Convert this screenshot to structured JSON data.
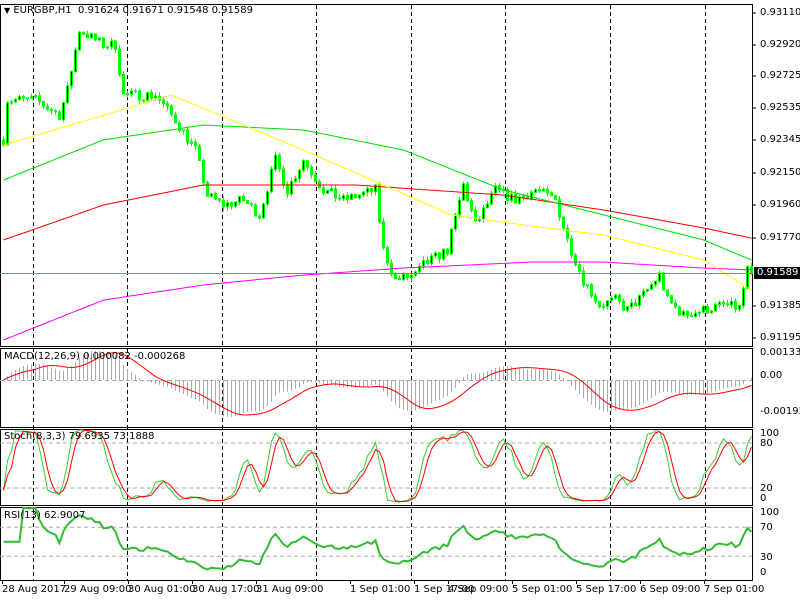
{
  "header": {
    "symbol_icon": "triangle-down-icon",
    "title": "EURGBP,H1",
    "open": "0.91624",
    "high": "0.91671",
    "low": "0.91548",
    "close": "0.91589"
  },
  "colors": {
    "candle": "#00ff00",
    "ma_fast": "#ffff00",
    "ma_mid": "#00dd00",
    "ma_slow": "#ff0000",
    "ma_long": "#ff00ff",
    "signal": "#ff0000",
    "stoch_main": "#33cc33",
    "stoch_signal": "#ff0000",
    "rsi": "#33bb33",
    "grid": "#000000"
  },
  "price_axis": [
    "0.93110",
    "0.92920",
    "0.92725",
    "0.92535",
    "0.92345",
    "0.92150",
    "0.91960",
    "0.91770",
    "0.91589",
    "0.91385",
    "0.91195"
  ],
  "current_price": "0.91589",
  "macd": {
    "label": "MACD(12,26,9) 0.000082 -0.000268",
    "axis": [
      "0.001335",
      "0.00",
      "-0.001927"
    ]
  },
  "stoch": {
    "label": "Stoch(8,3,3) 79.6935 73.1888",
    "axis": [
      "100",
      "80",
      "20",
      "0"
    ]
  },
  "rsi": {
    "label": "RSI(13) 62.9007",
    "axis": [
      "100",
      "70",
      "30",
      "0"
    ]
  },
  "time_axis": [
    "28 Aug 2017",
    "29 Aug 09:00",
    "30 Aug 01:00",
    "30 Aug 17:00",
    "31 Aug 09:00",
    "1 Sep 01:00",
    "1 Sep 17:00",
    "4 Sep 09:00",
    "5 Sep 01:00",
    "5 Sep 17:00",
    "6 Sep 09:00",
    "7 Sep 01:00"
  ],
  "chart_data": {
    "type": "candlestick",
    "bars": 188,
    "price_range": [
      0.91195,
      0.9311
    ],
    "close_anchors": [
      [
        0,
        0.92369
      ],
      [
        1,
        0.92602
      ],
      [
        8,
        0.92602
      ],
      [
        14,
        0.92514
      ],
      [
        16,
        0.9266
      ],
      [
        19,
        0.93011
      ],
      [
        25,
        0.92923
      ],
      [
        28,
        0.92923
      ],
      [
        30,
        0.92631
      ],
      [
        38,
        0.92631
      ],
      [
        43,
        0.92485
      ],
      [
        48,
        0.9231
      ],
      [
        51,
        0.92047
      ],
      [
        55,
        0.91989
      ],
      [
        60,
        0.92018
      ],
      [
        64,
        0.91931
      ],
      [
        68,
        0.92252
      ],
      [
        71,
        0.92077
      ],
      [
        75,
        0.92252
      ],
      [
        80,
        0.92077
      ],
      [
        85,
        0.92018
      ],
      [
        93,
        0.92077
      ],
      [
        95,
        0.91726
      ],
      [
        98,
        0.91551
      ],
      [
        103,
        0.9158
      ],
      [
        105,
        0.91639
      ],
      [
        111,
        0.91726
      ],
      [
        115,
        0.92106
      ],
      [
        118,
        0.91872
      ],
      [
        123,
        0.92077
      ],
      [
        128,
        0.92018
      ],
      [
        133,
        0.92077
      ],
      [
        138,
        0.92018
      ],
      [
        141,
        0.91785
      ],
      [
        145,
        0.91551
      ],
      [
        149,
        0.91405
      ],
      [
        153,
        0.91434
      ],
      [
        156,
        0.91376
      ],
      [
        160,
        0.91464
      ],
      [
        164,
        0.9158
      ],
      [
        166,
        0.91434
      ],
      [
        170,
        0.91347
      ],
      [
        175,
        0.91376
      ],
      [
        180,
        0.91405
      ],
      [
        184,
        0.91388
      ],
      [
        186,
        0.9161
      ],
      [
        187,
        0.91589
      ]
    ],
    "ma_yellow": [
      [
        0,
        0.92339
      ],
      [
        42,
        0.92631
      ],
      [
        75,
        0.9231
      ],
      [
        112,
        0.91931
      ],
      [
        130,
        0.91872
      ],
      [
        150,
        0.91814
      ],
      [
        175,
        0.91668
      ],
      [
        187,
        0.91493
      ]
    ],
    "ma_green": [
      [
        0,
        0.92135
      ],
      [
        25,
        0.92369
      ],
      [
        50,
        0.92456
      ],
      [
        75,
        0.92427
      ],
      [
        100,
        0.9231
      ],
      [
        125,
        0.92077
      ],
      [
        150,
        0.91931
      ],
      [
        175,
        0.91785
      ],
      [
        187,
        0.91668
      ]
    ],
    "ma_red": [
      [
        0,
        0.91785
      ],
      [
        25,
        0.91989
      ],
      [
        50,
        0.92106
      ],
      [
        88,
        0.92106
      ],
      [
        125,
        0.92047
      ],
      [
        150,
        0.9196
      ],
      [
        175,
        0.91855
      ],
      [
        187,
        0.91796
      ]
    ],
    "ma_magenta": [
      [
        0,
        0.91201
      ],
      [
        25,
        0.91434
      ],
      [
        50,
        0.91522
      ],
      [
        75,
        0.9158
      ],
      [
        100,
        0.91621
      ],
      [
        132,
        0.91656
      ],
      [
        150,
        0.91656
      ],
      [
        175,
        0.91621
      ],
      [
        187,
        0.9161
      ]
    ]
  }
}
